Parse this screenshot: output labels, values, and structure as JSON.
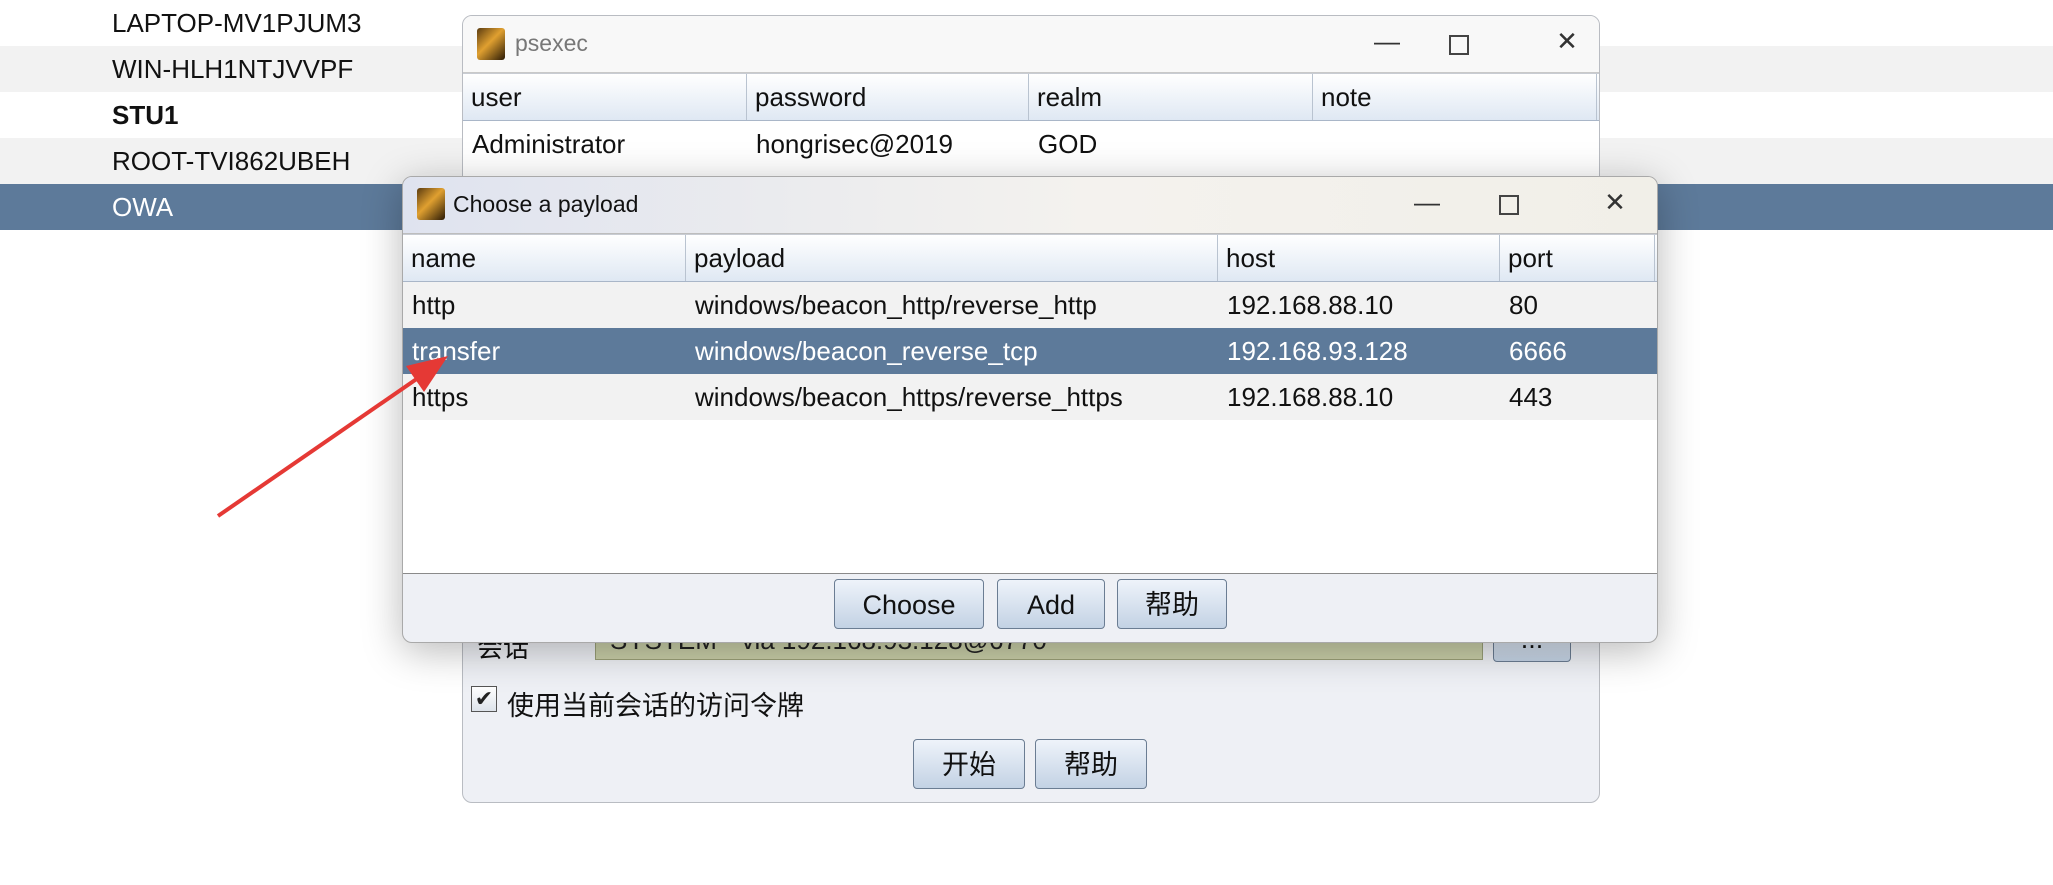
{
  "hosts": [
    {
      "name": "LAPTOP-MV1PJUM3"
    },
    {
      "name": "WIN-HLH1NTJVVPF"
    },
    {
      "name": "STU1"
    },
    {
      "name": "ROOT-TVI862UBEH"
    },
    {
      "name": "OWA"
    }
  ],
  "psexec": {
    "title": "psexec",
    "columns": [
      "user",
      "password",
      "realm",
      "note"
    ],
    "rows": [
      [
        "Administrator",
        "hongrisec@2019",
        "GOD",
        ""
      ]
    ],
    "session_label": "会话",
    "session_value": "SYSTEM * via 192.168.93.128@6770",
    "session_browse": "...",
    "use_token_label": "使用当前会话的访问令牌",
    "use_token_checked": true,
    "start_label": "开始",
    "help_label": "帮助"
  },
  "payload_dialog": {
    "title": "Choose a payload",
    "columns": [
      "name",
      "payload",
      "host",
      "port"
    ],
    "rows": [
      [
        "http",
        "windows/beacon_http/reverse_http",
        "192.168.88.10",
        "80"
      ],
      [
        "transfer",
        "windows/beacon_reverse_tcp",
        "192.168.93.128",
        "6666"
      ],
      [
        "https",
        "windows/beacon_https/reverse_https",
        "192.168.88.10",
        "443"
      ]
    ],
    "selected_row": 1,
    "choose_label": "Choose",
    "add_label": "Add",
    "help_label": "帮助"
  },
  "window_controls": {
    "minimize": "—",
    "close": "✕"
  },
  "colors": {
    "selection": "#5d7a9a",
    "arrow": "#e53935"
  }
}
